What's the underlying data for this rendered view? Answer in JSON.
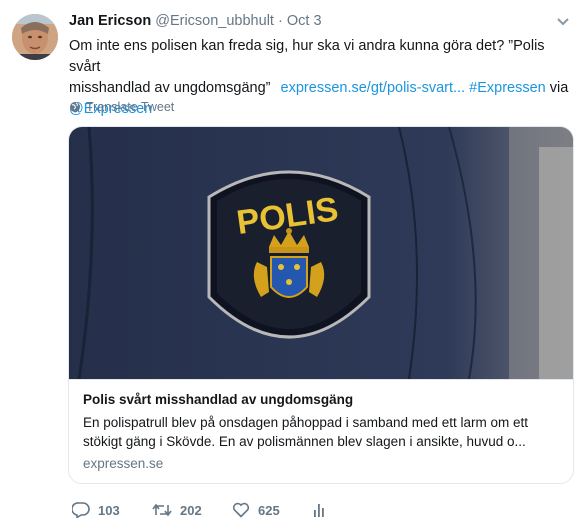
{
  "tweet": {
    "name": "Jan Ericson",
    "handle": "@Ericson_ubbhult",
    "separator": "·",
    "date": "Oct 3",
    "text_line1": "Om inte ens polisen kan freda sig, hur ska vi andra kunna göra det? ”Polis svårt",
    "text_line2_plain": "misshandlad av ungdomsgäng”",
    "link_url": "expressen.se/gt/polis-svart...",
    "hashtag": "#Expressen",
    "via": "via",
    "mention": "@Expressen",
    "translate_label": "Translate Tweet"
  },
  "card": {
    "badge_text": "POLIS",
    "title": "Polis svårt misshandlad av ungdomsgäng",
    "description_line1": "En polispatrull blev på onsdagen påhoppad i samband med ett larm om ett",
    "description_line2": "stökigt gäng i Skövde. En av polismännen blev slagen i ansikte, huvud o...",
    "domain": "expressen.se"
  },
  "actions": {
    "replies": "103",
    "retweets": "202",
    "likes": "625"
  },
  "colors": {
    "link": "#1b95e0",
    "muted": "#657786",
    "text": "#14171a"
  }
}
